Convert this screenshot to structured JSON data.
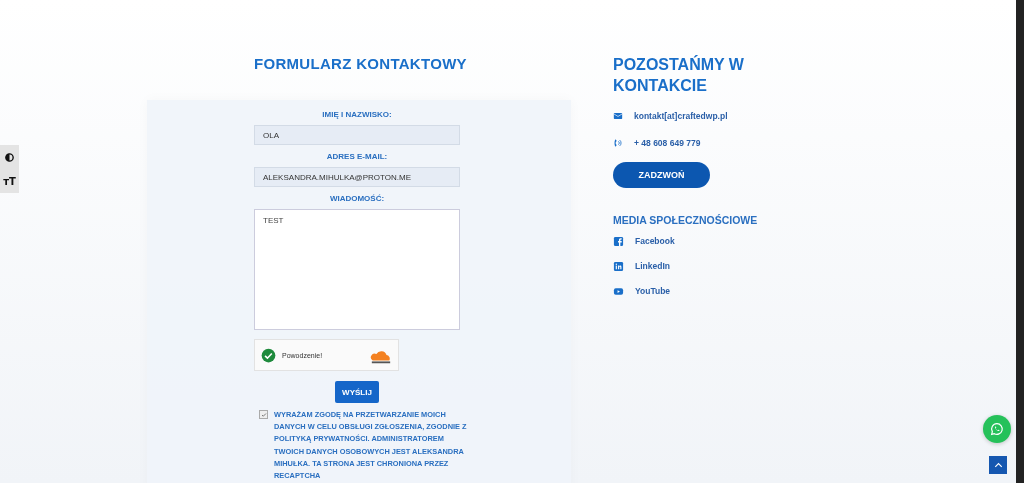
{
  "accessibility_toolbar": {
    "items": [
      {
        "kind": "contrast"
      },
      {
        "kind": "text-size",
        "text": "ᴛT"
      }
    ]
  },
  "contact_form": {
    "title": "FORMULARZ KONTAKTOWY",
    "fields": [
      {
        "kind": "input",
        "label": "IMIĘ I NAZWISKO:",
        "value": "OLA"
      },
      {
        "kind": "input",
        "label": "ADRES E-MAIL:",
        "value": "ALEKSANDRA.MIHULKA@PROTON.ME"
      },
      {
        "kind": "textarea",
        "label": "WIADOMOŚĆ:",
        "value": "TEST"
      }
    ],
    "captcha": {
      "status": "Powodzenie!",
      "success": true
    },
    "submit": "WYŚLIJ",
    "consent": {
      "checked": true,
      "text": "WYRAŻAM ZGODĘ NA PRZETWARZANIE MOICH DANYCH W CELU OBSŁUGI ZGŁOSZENIA, ZGODNIE Z POLITYKĄ PRYWATNOŚCI. ADMINISTRATOREM TWOICH DANYCH OSOBOWYCH JEST ALEKSANDRA MIHUŁKA. TA STRONA JEST CHRONIONA PRZEZ RECAPTCHA"
    }
  },
  "contact_info": {
    "title": "POZOSTAŃMY W KONTAKCIE",
    "items": [
      {
        "kind": "email",
        "text": "kontakt[at]craftedwp.pl"
      },
      {
        "kind": "phone",
        "text": "+ 48 608 649 779"
      }
    ],
    "call_button": "ZADZWOŃ",
    "social_title": "MEDIA SPOŁECZNOŚCIOWE",
    "social": [
      {
        "kind": "facebook",
        "text": "Facebook"
      },
      {
        "kind": "linkedin",
        "text": "LinkedIn"
      },
      {
        "kind": "youtube",
        "text": "YouTube"
      }
    ]
  },
  "floating": [
    {
      "kind": "whatsapp"
    },
    {
      "kind": "scroll-top"
    }
  ]
}
